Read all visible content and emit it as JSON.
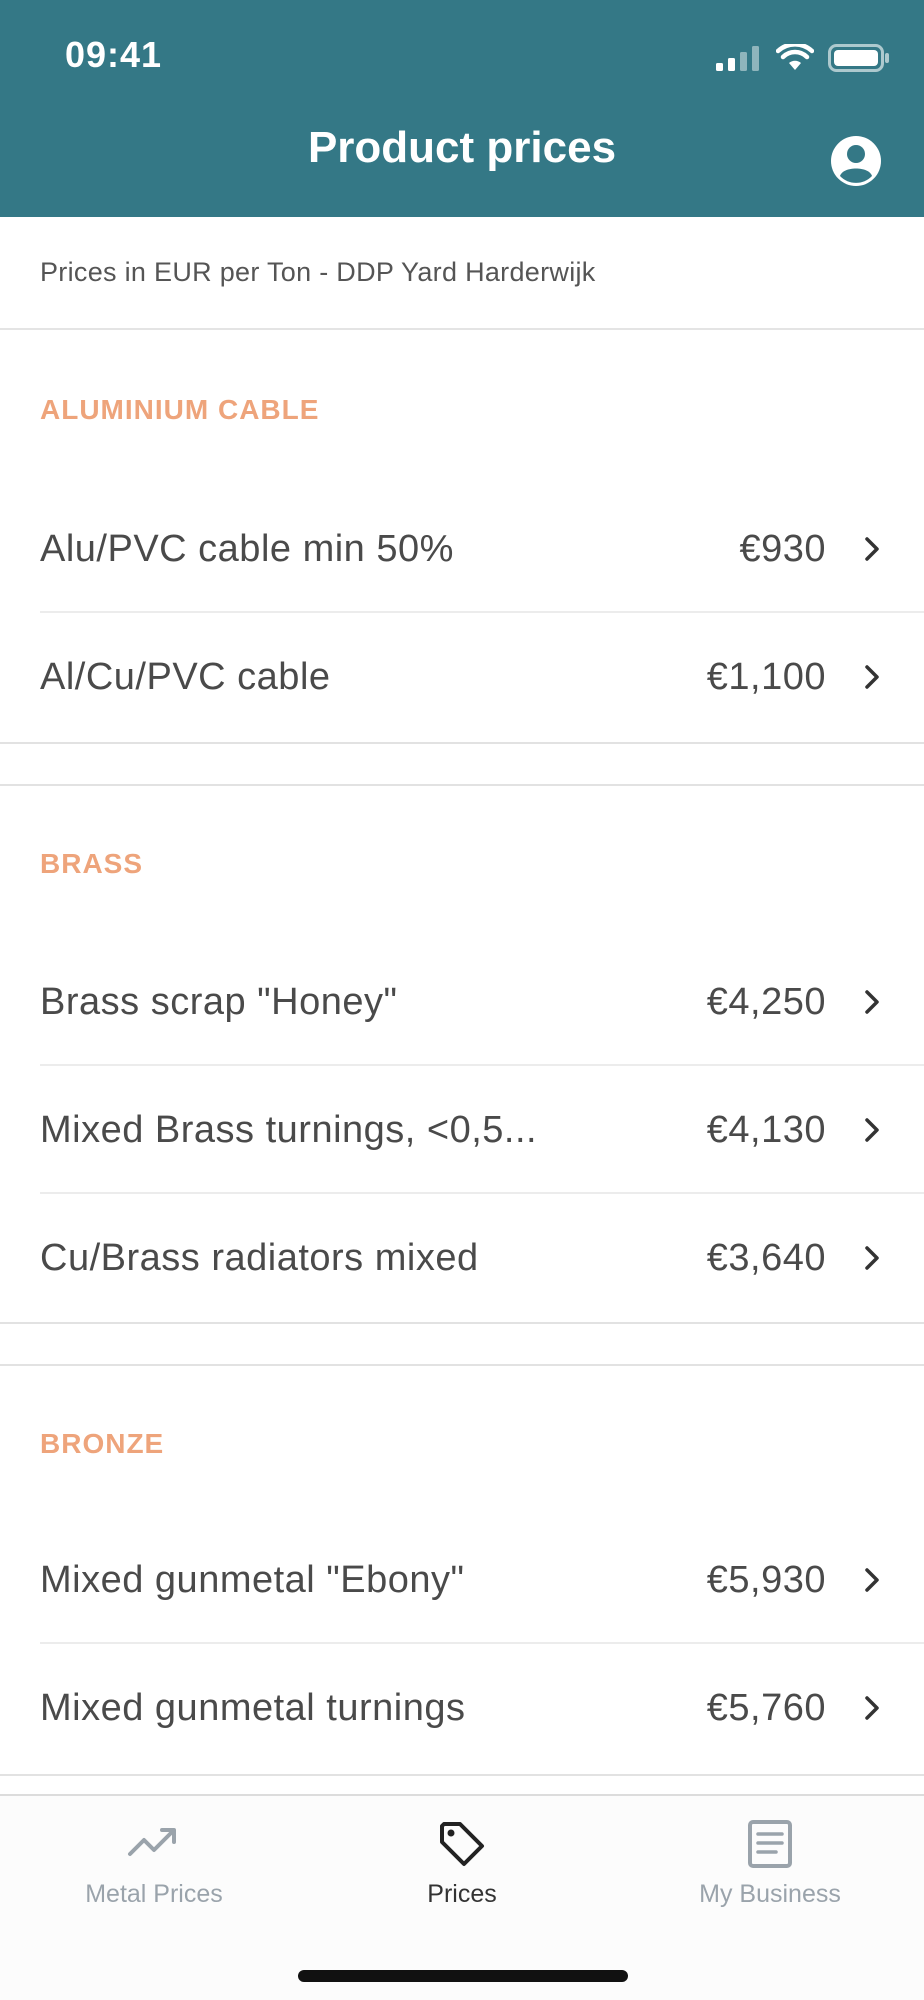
{
  "status_bar": {
    "time": "09:41"
  },
  "header": {
    "title": "Product prices",
    "profile_icon": "user-circle-icon"
  },
  "subtitle": "Prices in EUR per Ton - DDP Yard Harderwijk",
  "colors": {
    "header_bg": "#347886",
    "section_header": "#eea47b",
    "active_tab": "#333333",
    "inactive_tab": "#9aa3ab"
  },
  "sections": [
    {
      "title": "ALUMINIUM CABLE",
      "items": [
        {
          "name": "Alu/PVC cable min 50%",
          "price": "€930"
        },
        {
          "name": "Al/Cu/PVC cable",
          "price": "€1,100"
        }
      ]
    },
    {
      "title": "BRASS",
      "items": [
        {
          "name": "Brass scrap \"Honey\"",
          "price": "€4,250"
        },
        {
          "name": "Mixed Brass turnings, <0,5...",
          "price": "€4,130"
        },
        {
          "name": "Cu/Brass radiators mixed",
          "price": "€3,640"
        }
      ]
    },
    {
      "title": "BRONZE",
      "items": [
        {
          "name": "Mixed gunmetal \"Ebony\"",
          "price": "€5,930"
        },
        {
          "name": "Mixed gunmetal turnings",
          "price": "€5,760"
        }
      ]
    }
  ],
  "tabbar": {
    "tabs": [
      {
        "label": "Metal Prices",
        "icon": "trending-up-icon",
        "active": false
      },
      {
        "label": "Prices",
        "icon": "tag-icon",
        "active": true
      },
      {
        "label": "My Business",
        "icon": "document-icon",
        "active": false
      }
    ]
  }
}
